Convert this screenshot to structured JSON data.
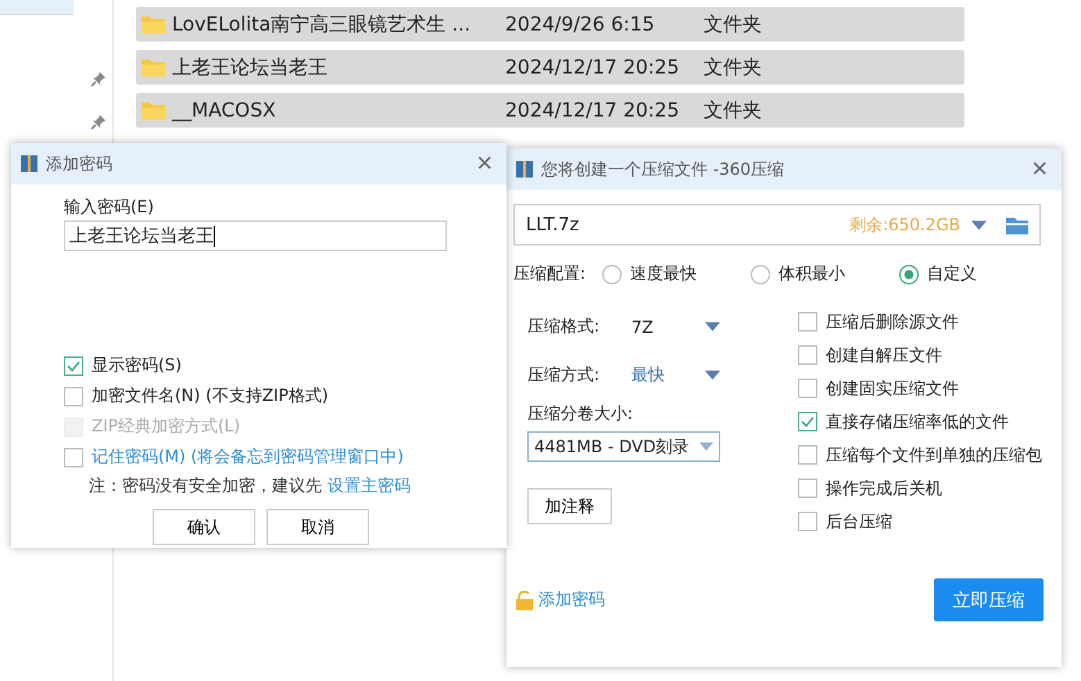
{
  "sidebar": {
    "items": [
      {
        "pinned": false,
        "selected": true
      },
      {
        "pinned": true,
        "selected": false
      },
      {
        "pinned": true,
        "selected": false
      }
    ]
  },
  "files": [
    {
      "name": "LovELolita南宁高三眼镜艺术生 ...",
      "date": "2024/9/26 6:15",
      "type": "文件夹"
    },
    {
      "name": "上老王论坛当老王",
      "date": "2024/12/17 20:25",
      "type": "文件夹"
    },
    {
      "name": "__MACOSX",
      "date": "2024/12/17 20:25",
      "type": "文件夹"
    }
  ],
  "password_dialog": {
    "title": "添加密码",
    "close": "×",
    "field_label": "输入密码(E)",
    "value": "上老王论坛当老王",
    "options": [
      {
        "label": "显示密码(S)",
        "checked": true,
        "disabled": false,
        "link": false
      },
      {
        "label": "加密文件名(N) (不支持ZIP格式)",
        "checked": false,
        "disabled": false,
        "link": false
      },
      {
        "label": "ZIP经典加密方式(L)",
        "checked": false,
        "disabled": true,
        "link": false
      },
      {
        "label": "记住密码(M) (将会备忘到密码管理窗口中)",
        "checked": false,
        "disabled": false,
        "link": true
      }
    ],
    "note": "注：密码没有安全加密，建议先",
    "note_link": "设置主密码",
    "buttons": [
      "确认",
      "取消"
    ]
  },
  "compress_dialog": {
    "title": "您将创建一个压缩文件 -360压缩",
    "close": "×",
    "path": "LLT.7z",
    "free_space": "剩余:650.2GB",
    "profile_label": "压缩配置:",
    "profiles": [
      {
        "label": "速度最快",
        "selected": false
      },
      {
        "label": "体积最小",
        "selected": false
      },
      {
        "label": "自定义",
        "selected": true
      }
    ],
    "format_label": "压缩格式:",
    "format": "7Z",
    "method_label": "压缩方式:",
    "method": "最快",
    "volume_label": "压缩分卷大小:",
    "volume": "4481MB  - DVD刻录",
    "comment_button": "加注释",
    "options": [
      {
        "label": "压缩后删除源文件",
        "checked": false
      },
      {
        "label": "创建自解压文件",
        "checked": false
      },
      {
        "label": "创建固实压缩文件",
        "checked": false
      },
      {
        "label": "直接存储压缩率低的文件",
        "checked": true
      },
      {
        "label": "压缩每个文件到单独的压缩包",
        "checked": false
      },
      {
        "label": "操作完成后关机",
        "checked": false
      },
      {
        "label": "后台压缩",
        "checked": false
      }
    ],
    "add_password": "添加密码",
    "start_button": "立即压缩"
  }
}
